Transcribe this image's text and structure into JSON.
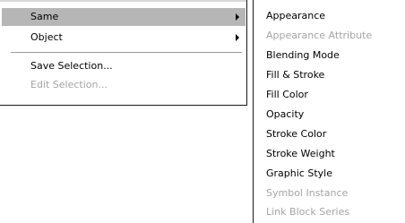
{
  "main_menu": {
    "items": [
      {
        "label": "Same",
        "has_submenu": true,
        "highlighted": true,
        "enabled": true
      },
      {
        "label": "Object",
        "has_submenu": true,
        "highlighted": false,
        "enabled": true
      },
      {
        "label": "Save Selection...",
        "has_submenu": false,
        "highlighted": false,
        "enabled": true
      },
      {
        "label": "Edit Selection...",
        "has_submenu": false,
        "highlighted": false,
        "enabled": false
      }
    ]
  },
  "submenu": {
    "items": [
      {
        "label": "Appearance",
        "enabled": true
      },
      {
        "label": "Appearance Attribute",
        "enabled": false
      },
      {
        "label": "Blending Mode",
        "enabled": true
      },
      {
        "label": "Fill & Stroke",
        "enabled": true
      },
      {
        "label": "Fill Color",
        "enabled": true
      },
      {
        "label": "Opacity",
        "enabled": true
      },
      {
        "label": "Stroke Color",
        "enabled": true
      },
      {
        "label": "Stroke Weight",
        "enabled": true
      },
      {
        "label": "Graphic Style",
        "enabled": true
      },
      {
        "label": "Symbol Instance",
        "enabled": false
      },
      {
        "label": "Link Block Series",
        "enabled": false
      }
    ]
  },
  "colors": {
    "highlight": "#b6b6b6",
    "disabled_text": "#a4a4a4",
    "border": "#1a1a1a"
  }
}
